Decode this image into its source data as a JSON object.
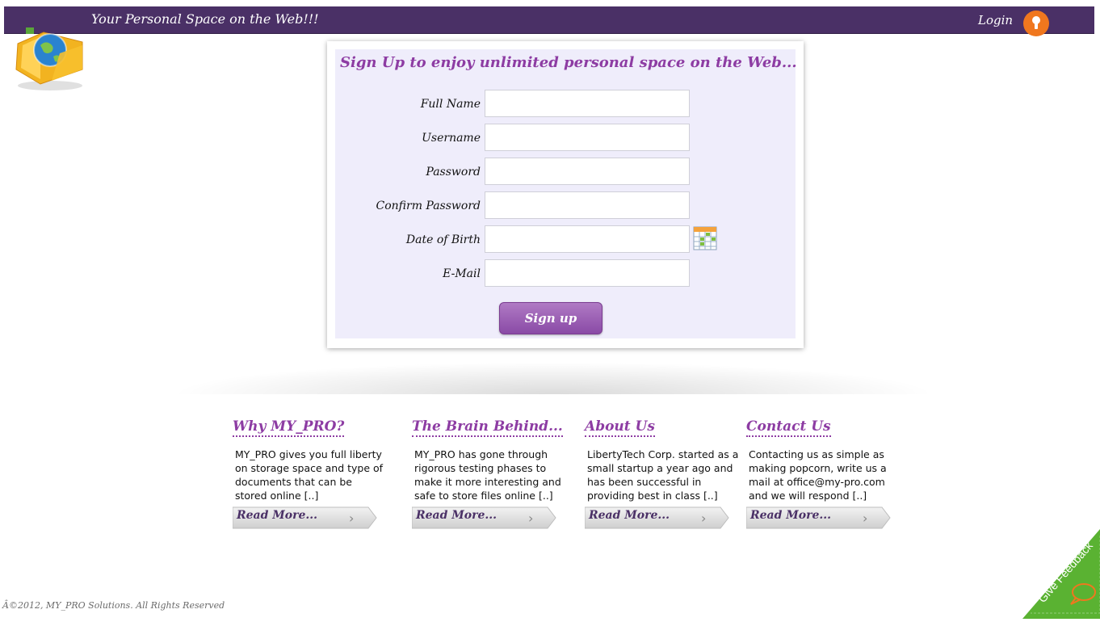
{
  "header": {
    "tagline": "Your Personal Space on the Web!!!",
    "login_label": "Login"
  },
  "form": {
    "heading": "Sign Up to enjoy unlimited personal space on the Web...",
    "fields": [
      {
        "label": "Full Name",
        "value": ""
      },
      {
        "label": "Username",
        "value": ""
      },
      {
        "label": "Password",
        "value": ""
      },
      {
        "label": "Confirm Password",
        "value": ""
      },
      {
        "label": "Date of Birth",
        "value": ""
      },
      {
        "label": "E-Mail",
        "value": ""
      }
    ],
    "submit_label": "Sign up"
  },
  "info": [
    {
      "title": "Why MY_PRO?",
      "body": "MY_PRO gives you full liberty on storage space and type of documents that can be stored online [..]",
      "link": "Read More..."
    },
    {
      "title": "The Brain Behind...",
      "body": "MY_PRO has gone through rigorous testing phases to make it more interesting and safe to store files online [..]",
      "link": "Read More..."
    },
    {
      "title": "About Us",
      "body": "LibertyTech Corp. started as a small startup a year ago and has been successful in providing best in class [..]",
      "link": "Read More..."
    },
    {
      "title": "Contact Us",
      "body": "Contacting us as simple as making popcorn, write us a mail at office@my-pro.com and we will respond [..]",
      "link": "Read More..."
    }
  ],
  "footer": {
    "copyright": "Â©2012, MY_PRO Solutions. All Rights Reserved",
    "feedback_label": "Give Feedback"
  },
  "icons": {
    "logo": "globe-folder-icon",
    "login": "keyhole-icon",
    "calendar": "calendar-icon",
    "arrow": "chevron-right-icon",
    "feedback": "speech-bubble-icon"
  },
  "colors": {
    "header_bg": "#4a3066",
    "accent": "#8d3ca3",
    "form_bg": "#efedfb",
    "login_icon": "#f0771e",
    "feedback": "#5ab232"
  }
}
